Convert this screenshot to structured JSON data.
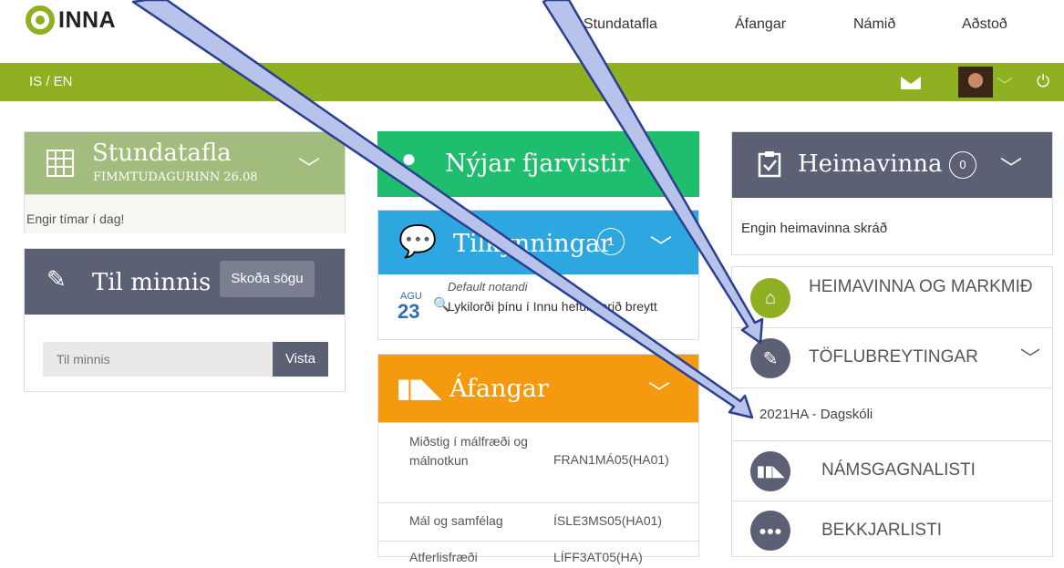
{
  "header": {
    "logo_text": "INNA",
    "nav": [
      "Stundatafla",
      "Áfangar",
      "Námið",
      "Aðstoð"
    ]
  },
  "toolbar": {
    "lang": "IS / EN"
  },
  "stundatafla": {
    "title": "Stundatafla",
    "date": "FIMMTUDAGURINN 26.08",
    "empty": "Engir tímar í dag!"
  },
  "minnis": {
    "title": "Til minnis",
    "history_button": "Skoða sögu",
    "input_placeholder": "Til minnis",
    "save_button": "Vista"
  },
  "fjarvistir": {
    "title": "Nýjar fjarvistir"
  },
  "tilkynningar": {
    "title": "Tilkynningar",
    "count": "1",
    "item": {
      "month": "AGU",
      "day": "23",
      "author": "Default notandi",
      "text": "Lykilorði þínu í Innu hefur verið breytt"
    }
  },
  "afangar": {
    "title": "Áfangar",
    "rows": [
      {
        "name": "Miðstig í málfræði og málnotkun",
        "code": "FRAN1MÁ05(HA01)"
      },
      {
        "name": "Mál og samfélag",
        "code": "ÍSLE3MS05(HA01)"
      },
      {
        "name": "Atferlisfræði",
        "code": "LÍFF3AT05(HA)"
      }
    ]
  },
  "heimavinna": {
    "title": "Heimavinna",
    "count": "0",
    "empty": "Engin heimavinna skráð"
  },
  "links": {
    "markmid": "HEIMAVINNA OG MARKMIÐ",
    "breytingar": "TÖFLUBREYTINGAR",
    "dagskoli": "2021HA - Dagskóli",
    "namsgogn": "NÁMSGAGNALISTI",
    "bekkur": "BEKKJARLISTI"
  },
  "colors": {
    "green": "#8eb021",
    "sage": "#a1bc7c",
    "slate": "#5b6075",
    "teal": "#1fbe6e",
    "blue": "#2ea6e0",
    "orange": "#f59a0e"
  }
}
